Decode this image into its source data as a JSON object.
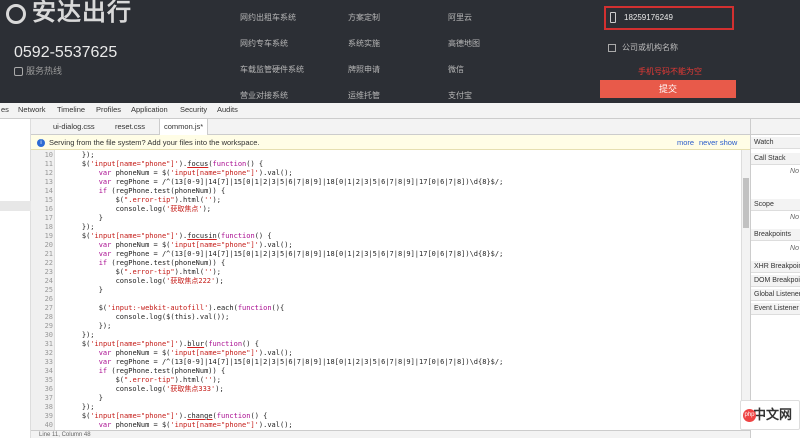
{
  "site": {
    "logo": "安达出行",
    "phone": "0592-5537625",
    "phone_sub": "服务热线",
    "links": [
      "网约出租车系统",
      "网约专车系统",
      "车载监管硬件系统",
      "营业对接系统",
      "方案定制",
      "系统实施",
      "牌照申请",
      "运维托管",
      "阿里云",
      "高德地图",
      "微信",
      "支付宝"
    ],
    "form": {
      "phone_value": "18259176249",
      "org_placeholder": "公司或机构名称",
      "error": "手机号码不能为空",
      "submit": "提交"
    }
  },
  "devtools": {
    "tabs": [
      "es",
      "Network",
      "Timeline",
      "Profiles",
      "Application",
      "Security",
      "Audits"
    ],
    "files": [
      "ui-dialog.css",
      "reset.css",
      "common.js*"
    ],
    "info": "Serving from the file system? Add your files into the workspace.",
    "more": "more",
    "never_show": "never show",
    "status": "Line 11, Column 48",
    "right_panel": [
      "Watch",
      "Call Stack",
      "No",
      "Scope",
      "No",
      "Breakpoints",
      "No",
      "XHR Breakpoints",
      "DOM Breakpoints",
      "Global Listeners",
      "Event Listener"
    ],
    "code": [
      {
        "n": "10",
        "t": "    });"
      },
      {
        "n": "11",
        "t": "    $('input[name=\"phone\"]').focus(function() {"
      },
      {
        "n": "12",
        "t": "        var phoneNum = $('input[name=\"phone\"]').val();"
      },
      {
        "n": "13",
        "t": "        var regPhone = /^(13[0-9]|14[7]|15[0|1|2|3|5|6|7|8|9]|18[0|1|2|3|5|6|7|8|9]|17[0|6|7|8])\\d{8}$/;"
      },
      {
        "n": "14",
        "t": "        if (regPhone.test(phoneNum)) {"
      },
      {
        "n": "15",
        "t": "            $(\".error-tip\").html('');"
      },
      {
        "n": "16",
        "t": "            console.log('获取焦点');"
      },
      {
        "n": "17",
        "t": "        }"
      },
      {
        "n": "18",
        "t": "    });"
      },
      {
        "n": "19",
        "t": "    $('input[name=\"phone\"]').focusin(function() {"
      },
      {
        "n": "20",
        "t": "        var phoneNum = $('input[name=\"phone\"]').val();"
      },
      {
        "n": "21",
        "t": "        var regPhone = /^(13[0-9]|14[7]|15[0|1|2|3|5|6|7|8|9]|18[0|1|2|3|5|6|7|8|9]|17[0|6|7|8])\\d{8}$/;"
      },
      {
        "n": "22",
        "t": "        if (regPhone.test(phoneNum)) {"
      },
      {
        "n": "23",
        "t": "            $(\".error-tip\").html('');"
      },
      {
        "n": "24",
        "t": "            console.log('获取焦点222');"
      },
      {
        "n": "25",
        "t": "        }"
      },
      {
        "n": "26",
        "t": ""
      },
      {
        "n": "27",
        "t": "        $('input:-webkit-autofill').each(function(){"
      },
      {
        "n": "28",
        "t": "            console.log($(this).val());"
      },
      {
        "n": "29",
        "t": "        });"
      },
      {
        "n": "30",
        "t": "    });"
      },
      {
        "n": "31",
        "t": "    $('input[name=\"phone\"]').blur(function() {"
      },
      {
        "n": "32",
        "t": "        var phoneNum = $('input[name=\"phone\"]').val();"
      },
      {
        "n": "33",
        "t": "        var regPhone = /^(13[0-9]|14[7]|15[0|1|2|3|5|6|7|8|9]|18[0|1|2|3|5|6|7|8|9]|17[0|6|7|8])\\d{8}$/;"
      },
      {
        "n": "34",
        "t": "        if (regPhone.test(phoneNum)) {"
      },
      {
        "n": "35",
        "t": "            $(\".error-tip\").html('');"
      },
      {
        "n": "36",
        "t": "            console.log('获取焦点333');"
      },
      {
        "n": "37",
        "t": "        }"
      },
      {
        "n": "38",
        "t": "    });"
      },
      {
        "n": "39",
        "t": "    $('input[name=\"phone\"]').change(function() {"
      },
      {
        "n": "40",
        "t": "        var phoneNum = $('input[name=\"phone\"]').val();"
      }
    ]
  },
  "watermark": {
    "text": "中文网",
    "badge": "php"
  }
}
